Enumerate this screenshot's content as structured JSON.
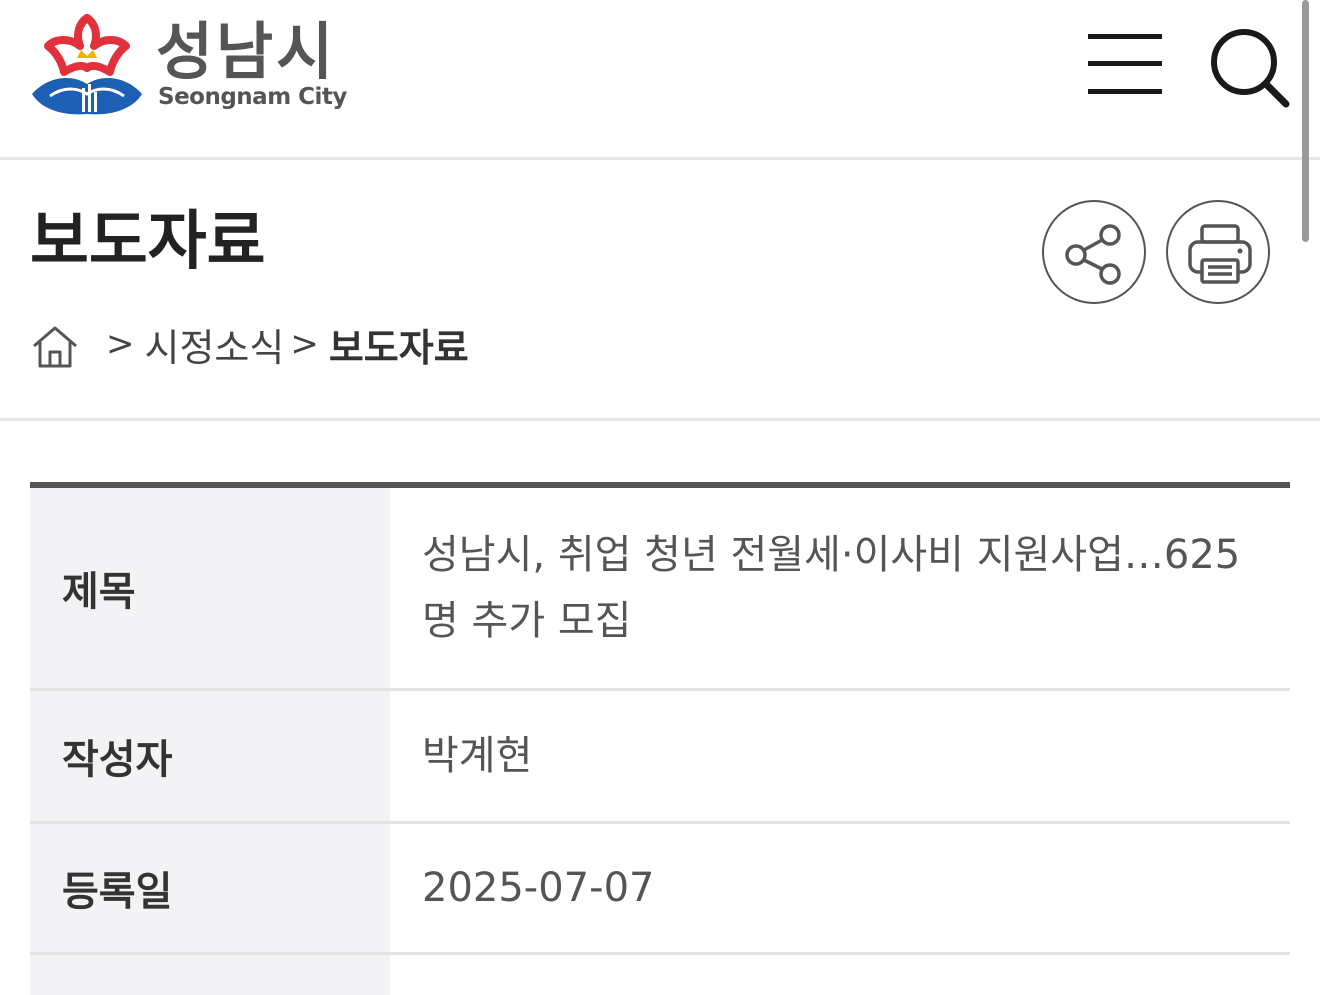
{
  "header": {
    "logo_kr": "성남시",
    "logo_en": "Seongnam City",
    "menu_icon": "hamburger-menu-icon",
    "search_icon": "search-icon"
  },
  "page": {
    "title": "보도자료",
    "share_icon": "share-icon",
    "print_icon": "printer-icon"
  },
  "breadcrumb": {
    "home_icon": "home-icon",
    "separator": ">",
    "items": [
      "시정소식",
      "보도자료"
    ]
  },
  "article": {
    "rows": [
      {
        "label": "제목",
        "value": "성남시, 취업 청년 전월세·이사비 지원사업…625명 추가 모집"
      },
      {
        "label": "작성자",
        "value": "박계현"
      },
      {
        "label": "등록일",
        "value": "2025-07-07"
      }
    ]
  },
  "colors": {
    "logo_red": "#e0313c",
    "logo_blue": "#1d5fb5",
    "logo_yellow": "#f0b400",
    "table_header_bg": "#f3f3f5",
    "table_top_border": "#555555"
  }
}
